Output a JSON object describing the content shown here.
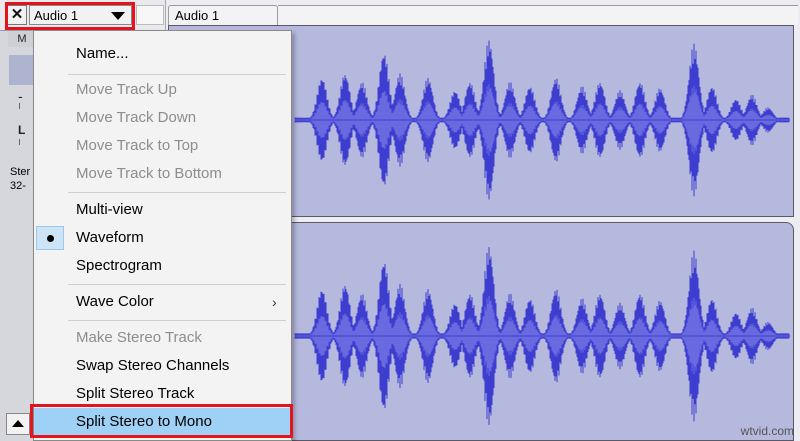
{
  "track": {
    "name": "Audio 1",
    "title": "Audio 1",
    "close_glyph": "✕",
    "mute_label": "M",
    "gain_label": "-",
    "pan_label": "L",
    "info_line1": "Ster",
    "info_line2": "32-"
  },
  "menu": {
    "items": [
      {
        "label": "Name...",
        "enabled": true
      },
      {
        "label": "Move Track Up",
        "enabled": false
      },
      {
        "label": "Move Track Down",
        "enabled": false
      },
      {
        "label": "Move Track to Top",
        "enabled": false
      },
      {
        "label": "Move Track to Bottom",
        "enabled": false
      },
      {
        "label": "Multi-view",
        "enabled": true
      },
      {
        "label": "Waveform",
        "enabled": true,
        "checked": true
      },
      {
        "label": "Spectrogram",
        "enabled": true
      },
      {
        "label": "Wave Color",
        "enabled": true,
        "submenu_glyph": "›"
      },
      {
        "label": "Make Stereo Track",
        "enabled": false
      },
      {
        "label": "Swap Stereo Channels",
        "enabled": true
      },
      {
        "label": "Split Stereo Track",
        "enabled": true
      },
      {
        "label": "Split Stereo to Mono",
        "enabled": true,
        "highlighted": true
      }
    ]
  },
  "watermark": "wtvid.com",
  "colors": {
    "waveform": "#3d3dcf",
    "waveform_rms": "#6a6ae0",
    "highlight_border": "#e3141b",
    "menu_hover": "#9fd0f5"
  },
  "icons": {
    "close": "close-icon",
    "dropdown": "triangle-down-icon",
    "collapse": "triangle-up-icon",
    "checked": "radio-dot-icon",
    "submenu": "chevron-right-icon"
  }
}
